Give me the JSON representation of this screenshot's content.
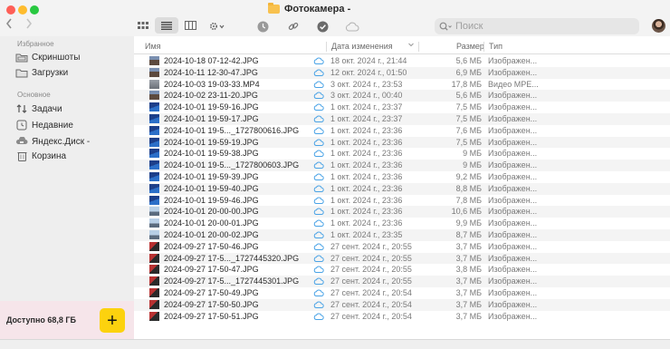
{
  "window": {
    "title": "Фотокамера -",
    "search_placeholder": "Поиск"
  },
  "toolbar": {
    "icons": [
      "chevron-left-icon",
      "chevron-right-icon",
      "grid-view-icon",
      "list-view-icon",
      "column-view-icon",
      "gear-menu-icon",
      "clock-icon",
      "link-icon",
      "checkmark-icon",
      "cloud-icon",
      "search-icon"
    ]
  },
  "sidebar": {
    "favorites_title": "Избранное",
    "favorites": [
      {
        "label": "Скриншоты",
        "icon": "folder-icon"
      },
      {
        "label": "Загрузки",
        "icon": "folder-icon"
      }
    ],
    "main_title": "Основное",
    "main": [
      {
        "label": "Задачи",
        "icon": "tasks-icon"
      },
      {
        "label": "Недавние",
        "icon": "clock-icon"
      },
      {
        "label": "Яндекс.Диск -",
        "icon": "disk-icon"
      },
      {
        "label": "Корзина",
        "icon": "trash-icon"
      }
    ],
    "storage": "Доступно 68,8 ГБ",
    "add_label": "+"
  },
  "columns": {
    "name": "Имя",
    "date": "Дата изменения",
    "size": "Размер",
    "type": "Тип"
  },
  "colors": {
    "accent_yellow": "#fcd20e",
    "cloud_blue": "#4aa3e6",
    "storage_bg": "#f6e5ea"
  },
  "files": [
    {
      "name": "2024-10-18 07-12-42.JPG",
      "date": "18 окт. 2024 г., 21:44",
      "size": "5,6 МБ",
      "type": "Изображен...",
      "thumb": "photo-portrait-icon"
    },
    {
      "name": "2024-10-11 12-30-47.JPG",
      "date": "12 окт. 2024 г., 01:50",
      "size": "6,9 МБ",
      "type": "Изображен...",
      "thumb": "photo-portrait-icon"
    },
    {
      "name": "2024-10-03 19-03-33.MP4",
      "date": "3 окт. 2024 г., 23:53",
      "size": "17,8 МБ",
      "type": "Видео MPE...",
      "thumb": "video-thumb-icon"
    },
    {
      "name": "2024-10-02 23-11-20.JPG",
      "date": "3 окт. 2024 г., 00:40",
      "size": "5,6 МБ",
      "type": "Изображен...",
      "thumb": "photo-portrait-icon"
    },
    {
      "name": "2024-10-01 19-59-16.JPG",
      "date": "1 окт. 2024 г., 23:37",
      "size": "7,5 МБ",
      "type": "Изображен...",
      "thumb": "photo-blue-icon"
    },
    {
      "name": "2024-10-01 19-59-17.JPG",
      "date": "1 окт. 2024 г., 23:37",
      "size": "7,5 МБ",
      "type": "Изображен...",
      "thumb": "photo-blue-icon"
    },
    {
      "name": "2024-10-01 19-5..._1727800616.JPG",
      "date": "1 окт. 2024 г., 23:36",
      "size": "7,6 МБ",
      "type": "Изображен...",
      "thumb": "photo-blue-icon"
    },
    {
      "name": "2024-10-01 19-59-19.JPG",
      "date": "1 окт. 2024 г., 23:36",
      "size": "7,5 МБ",
      "type": "Изображен...",
      "thumb": "photo-blue-icon"
    },
    {
      "name": "2024-10-01 19-59-38.JPG",
      "date": "1 окт. 2024 г., 23:36",
      "size": "9 МБ",
      "type": "Изображен...",
      "thumb": "photo-blue-icon"
    },
    {
      "name": "2024-10-01 19-5..._1727800603.JPG",
      "date": "1 окт. 2024 г., 23:36",
      "size": "9 МБ",
      "type": "Изображен...",
      "thumb": "photo-blue-icon"
    },
    {
      "name": "2024-10-01 19-59-39.JPG",
      "date": "1 окт. 2024 г., 23:36",
      "size": "9,2 МБ",
      "type": "Изображен...",
      "thumb": "photo-blue-icon"
    },
    {
      "name": "2024-10-01 19-59-40.JPG",
      "date": "1 окт. 2024 г., 23:36",
      "size": "8,8 МБ",
      "type": "Изображен...",
      "thumb": "photo-blue-icon"
    },
    {
      "name": "2024-10-01 19-59-46.JPG",
      "date": "1 окт. 2024 г., 23:36",
      "size": "7,8 МБ",
      "type": "Изображен...",
      "thumb": "photo-blue-icon"
    },
    {
      "name": "2024-10-01 20-00-00.JPG",
      "date": "1 окт. 2024 г., 23:36",
      "size": "10,6 МБ",
      "type": "Изображен...",
      "thumb": "photo-sky-icon"
    },
    {
      "name": "2024-10-01 20-00-01.JPG",
      "date": "1 окт. 2024 г., 23:36",
      "size": "9,9 МБ",
      "type": "Изображен...",
      "thumb": "photo-sky-icon"
    },
    {
      "name": "2024-10-01 20-00-02.JPG",
      "date": "1 окт. 2024 г., 23:35",
      "size": "8,7 МБ",
      "type": "Изображен...",
      "thumb": "photo-sky-icon"
    },
    {
      "name": "2024-09-27 17-50-46.JPG",
      "date": "27 сент. 2024 г., 20:55",
      "size": "3,7 МБ",
      "type": "Изображен...",
      "thumb": "photo-red-icon"
    },
    {
      "name": "2024-09-27 17-5..._1727445320.JPG",
      "date": "27 сент. 2024 г., 20:55",
      "size": "3,7 МБ",
      "type": "Изображен...",
      "thumb": "photo-red-icon"
    },
    {
      "name": "2024-09-27 17-50-47.JPG",
      "date": "27 сент. 2024 г., 20:55",
      "size": "3,8 МБ",
      "type": "Изображен...",
      "thumb": "photo-red-icon"
    },
    {
      "name": "2024-09-27 17-5..._1727445301.JPG",
      "date": "27 сент. 2024 г., 20:55",
      "size": "3,7 МБ",
      "type": "Изображен...",
      "thumb": "photo-red-icon"
    },
    {
      "name": "2024-09-27 17-50-49.JPG",
      "date": "27 сент. 2024 г., 20:54",
      "size": "3,7 МБ",
      "type": "Изображен...",
      "thumb": "photo-red-icon"
    },
    {
      "name": "2024-09-27 17-50-50.JPG",
      "date": "27 сент. 2024 г., 20:54",
      "size": "3,7 МБ",
      "type": "Изображен...",
      "thumb": "photo-red-icon"
    },
    {
      "name": "2024-09-27 17-50-51.JPG",
      "date": "27 сент. 2024 г., 20:54",
      "size": "3,7 МБ",
      "type": "Изображен...",
      "thumb": "photo-red-icon"
    }
  ]
}
